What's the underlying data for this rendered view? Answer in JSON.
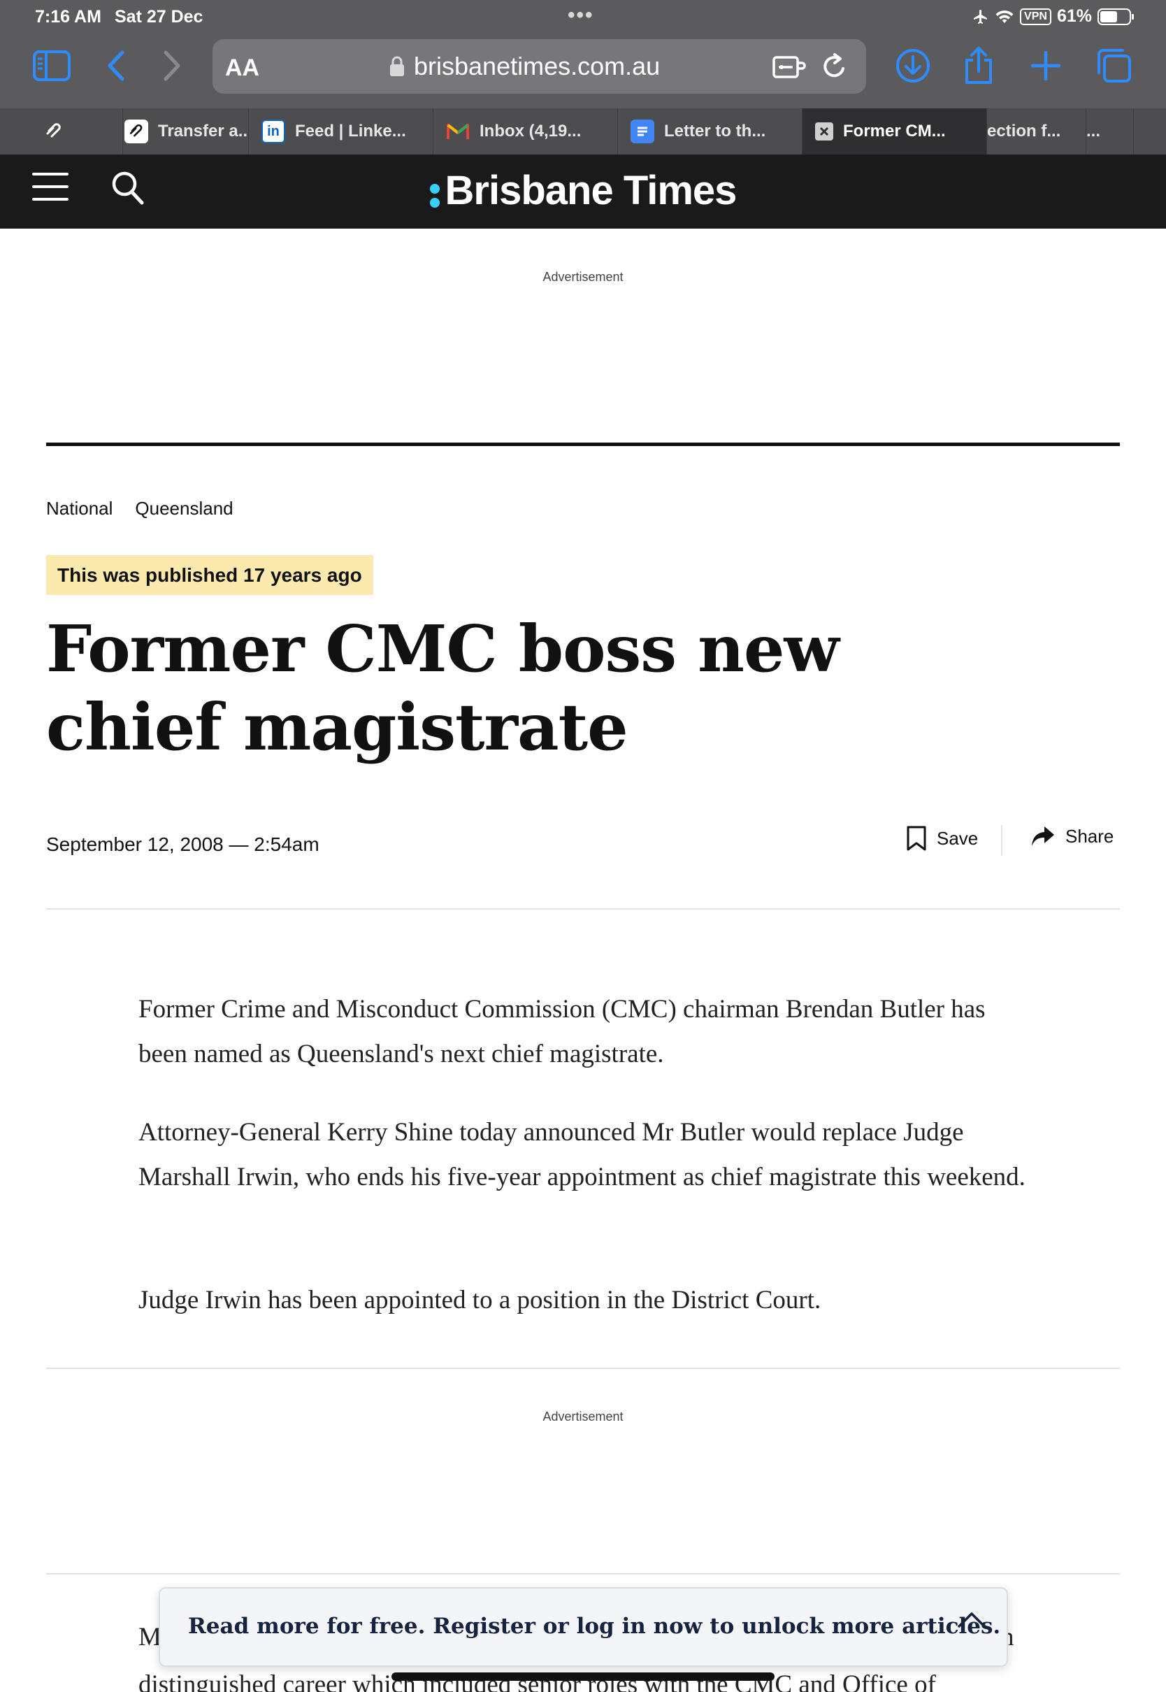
{
  "status_bar": {
    "time": "7:16 AM",
    "date": "Sat 27 Dec",
    "vpn": "VPN",
    "battery_text": "61%",
    "battery_level": 0.61
  },
  "browser": {
    "text_size_label": "AA",
    "url": "brisbanetimes.com.au",
    "accent_color": "#2f8cff"
  },
  "tabs": [
    {
      "label": "Transfer a...",
      "icon": "squarespace-icon"
    },
    {
      "label": "Feed | Linke...",
      "icon": "linkedin-icon"
    },
    {
      "label": "Inbox (4,19...",
      "icon": "gmail-icon"
    },
    {
      "label": "Letter to th...",
      "icon": "docs-icon"
    },
    {
      "label": "Former CM...",
      "icon": "close-icon",
      "active": true
    },
    {
      "label": "ection f...",
      "icon": ""
    },
    {
      "label": "...",
      "icon": ""
    }
  ],
  "site": {
    "brand": "Brisbane Times",
    "brand_accent": "#38d1ff"
  },
  "ads": {
    "top_label": "Advertisement",
    "mid_label": "Advertisement"
  },
  "article": {
    "breadcrumbs": [
      "National",
      "Queensland"
    ],
    "published_badge": "This was published 17 years ago",
    "headline": "Former CMC boss new chief magistrate",
    "dateline": "September 12, 2008 — 2:54am",
    "save_label": "Save",
    "share_label": "Share",
    "paragraphs": [
      "Former Crime and Misconduct Commission (CMC) chairman Brendan Butler has been named as Queensland's next chief magistrate.",
      "Attorney-General Kerry Shine today announced Mr Butler would replace Judge Marshall Irwin, who ends his five-year appointment as chief magistrate this weekend.",
      "Judge Irwin has been appointed to a position in the District Court."
    ],
    "partial_line_1_start": "M",
    "partial_line_1_end": "n",
    "partial_line_2": "distinguished career which included senior roles with the CMC and Office of"
  },
  "register_prompt": {
    "text": "Read more for free. Register or log in now to unlock more articles."
  }
}
